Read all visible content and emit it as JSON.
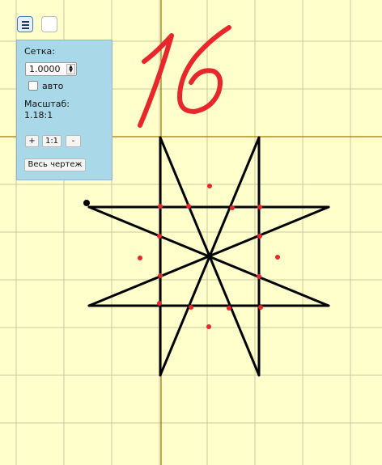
{
  "toolbar": {
    "menu_icon": "hamburger-menu-icon"
  },
  "settings_panel": {
    "grid_label": "Сетка:",
    "grid_value": "1.0000",
    "auto_label": "авто",
    "auto_checked": false,
    "scale_label": "Масштаб:",
    "scale_value": "1.18:1",
    "zoom_in_label": "+",
    "zoom_reset_label": "1:1",
    "zoom_out_label": "-",
    "fit_all_label": "Весь чертеж"
  },
  "drawing": {
    "handwritten_number": "16",
    "background_color": "#ffffcc",
    "grid_color": "#c8c8a0",
    "axis_color": "#a07800",
    "line_color": "#000000",
    "point_color": "#e8262c",
    "handwriting_color": "#e8262c"
  }
}
